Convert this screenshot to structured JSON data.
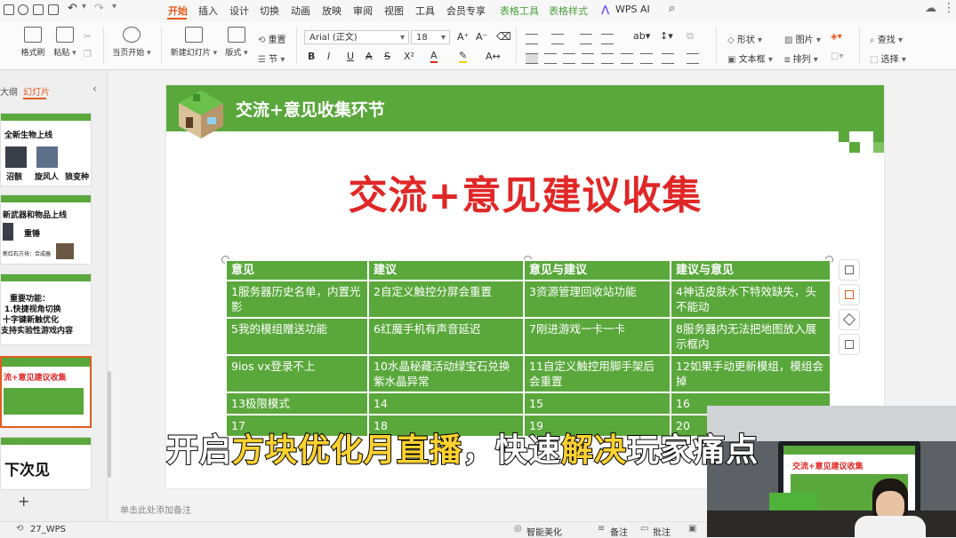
{
  "menu": {
    "tabs": [
      "开始",
      "插入",
      "设计",
      "切换",
      "动画",
      "放映",
      "审阅",
      "视图",
      "工具",
      "会员专享",
      "表格工具",
      "表格样式",
      "WPS AI"
    ],
    "active_tab": "开始"
  },
  "ribbon": {
    "format_painter": "格式刷",
    "paste": "粘贴",
    "start_from_current": "当页开始",
    "new_slide": "新建幻灯片",
    "layout": "版式",
    "reset": "重置",
    "section": "节",
    "font_name": "Arial (正文)",
    "font_size": "18",
    "shape": "形状",
    "picture": "图片",
    "textbox": "文本框",
    "arrange": "排列",
    "find": "查找",
    "select": "选择"
  },
  "left_panel": {
    "tab_outline": "大纲",
    "tab_slides": "幻灯片",
    "thumbs": [
      {
        "number": "",
        "title": "全新生物上线",
        "labels": [
          "沼骸",
          "旋风人",
          "狼变种"
        ]
      },
      {
        "number": "",
        "title": "新武器和物品上线",
        "labels": [
          "重锤",
          "新红石方块：合成器"
        ]
      },
      {
        "number": "",
        "lines": [
          "重要功能：",
          "1.快捷视角切换",
          "十字键新触优化",
          "支持实验性游戏内容"
        ]
      },
      {
        "number": "",
        "title": "流+意见建议收集"
      },
      {
        "number": "",
        "title": "下次见"
      }
    ],
    "add_slide": "+"
  },
  "slide": {
    "header_title": "交流+意见收集环节",
    "big_title": "交流+意见建议收集",
    "table": {
      "headers": [
        "意见",
        "建议",
        "意见与建议",
        "建议与意见"
      ],
      "rows": [
        [
          "1服务器历史名单，内置光影",
          "2自定义触控分屏会重置",
          "3资源管理回收站功能",
          "4神话皮肤水下特效缺失，头不能动"
        ],
        [
          "5我的模组赠送功能",
          "6红魔手机有声音延迟",
          "7刚进游戏一卡一卡",
          "8服务器内无法把地图放入展示框内"
        ],
        [
          "9ios vx登录不上",
          "10水晶秘藏活动绿宝石兑换紫水晶异常",
          "11自定义触控用脚手架后会重置",
          "12如果手动更新模组，模组会掉"
        ],
        [
          "13极限模式",
          "14",
          "15",
          "16"
        ],
        [
          "17",
          "18",
          "19",
          "20"
        ]
      ]
    }
  },
  "notes_placeholder": "单击此处添加备注",
  "status": {
    "slide_info": "27_WPS",
    "smart_beautify": "智能美化",
    "notes": "备注",
    "comments": "批注"
  },
  "subtitle": {
    "parts": [
      {
        "text": "开启",
        "color": "white"
      },
      {
        "text": "方块优化月直播",
        "color": "yellow"
      },
      {
        "text": "，快速",
        "color": "white"
      },
      {
        "text": "解决",
        "color": "yellow"
      },
      {
        "text": "玩家痛点",
        "color": "white"
      }
    ]
  },
  "webcam": {
    "screen_title": "交流+意见建议收集"
  },
  "colors": {
    "accent_orange": "#e25b1d",
    "slide_green": "#5aa83c",
    "title_red": "#e02727",
    "subtitle_yellow": "#ffd230"
  }
}
